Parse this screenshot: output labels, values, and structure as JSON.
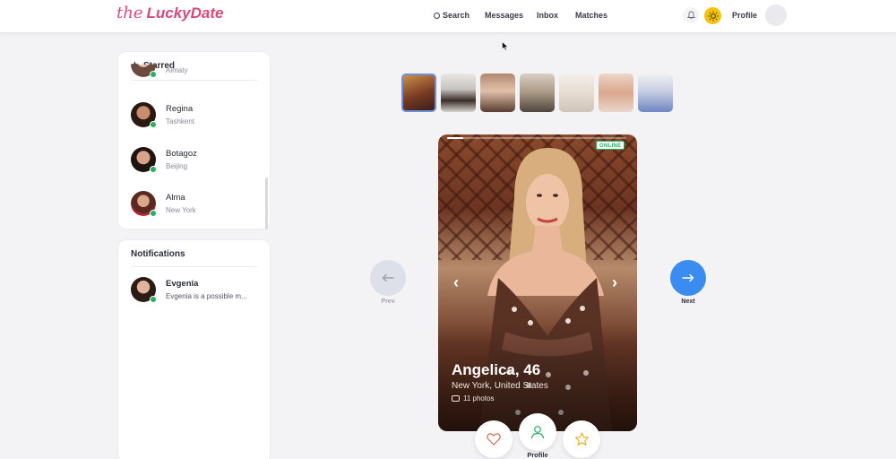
{
  "brand": {
    "logo_prefix": "the",
    "logo_name": "LuckyDate",
    "accent": "#d94a7a"
  },
  "nav": {
    "search": "Search",
    "messages": "Messages",
    "inbox": "Inbox",
    "matches": "Matches",
    "profile": "Profile"
  },
  "starred": {
    "title": "Starred",
    "partial_city": "Almaty",
    "items": [
      {
        "name": "Regina",
        "city": "Tashkent",
        "online": true
      },
      {
        "name": "Botagoz",
        "city": "Beijing",
        "online": true
      },
      {
        "name": "Alma",
        "city": "New York",
        "online": true
      }
    ]
  },
  "notifications": {
    "title": "Notifications",
    "items": [
      {
        "name": "Evgenia",
        "message": "Evgenia is a possible m...",
        "online": true
      }
    ]
  },
  "thumbnails": {
    "count": 7,
    "active_index": 0
  },
  "card": {
    "status": "ONLINE",
    "name_age": "Angelica, 46",
    "location": "New York, United States",
    "photos": "11 photos",
    "progress_fraction": 0.09
  },
  "controls": {
    "prev": "Prev",
    "next": "Next",
    "profile": "Profile",
    "next_color": "#3b8cf0",
    "online_color": "#27ae60"
  }
}
